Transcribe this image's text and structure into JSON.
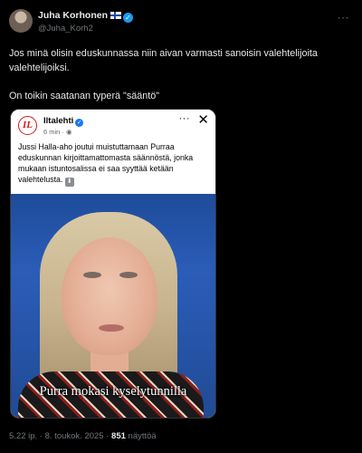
{
  "author": {
    "display_name": "Juha Korhonen",
    "handle": "@Juha_Korh2",
    "flag": "finland-flag",
    "verified": true
  },
  "post": {
    "text_line1": "Jos minä olisin eduskunnassa niin aivan varmasti sanoisin valehtelijoita valehtelijoiksi.",
    "text_line2": "On toikin saatanan typerä \"sääntö\""
  },
  "embedded": {
    "source_name": "Iltalehti",
    "logo_text": "IL",
    "time": "6 min · ",
    "text": "Jussi Halla-aho joutui muistuttamaan Purraa eduskunnan kirjoittamattomasta säännöstä, jonka mukaan istuntosalissa ei saa syyttää ketään valehtelusta. ",
    "caption": "Purra mokasi kyselytunnilla"
  },
  "meta": {
    "time": "5.22 ip.",
    "sep1": " · ",
    "date": "8. toukok. 2025",
    "sep2": " · ",
    "views_count": "851",
    "views_label": " näyttöä"
  },
  "colors": {
    "background": "#000000",
    "text": "#e7e9ea",
    "muted": "#71767b",
    "verified": "#1d9bf0",
    "iltalehti_red": "#d31a1a"
  }
}
